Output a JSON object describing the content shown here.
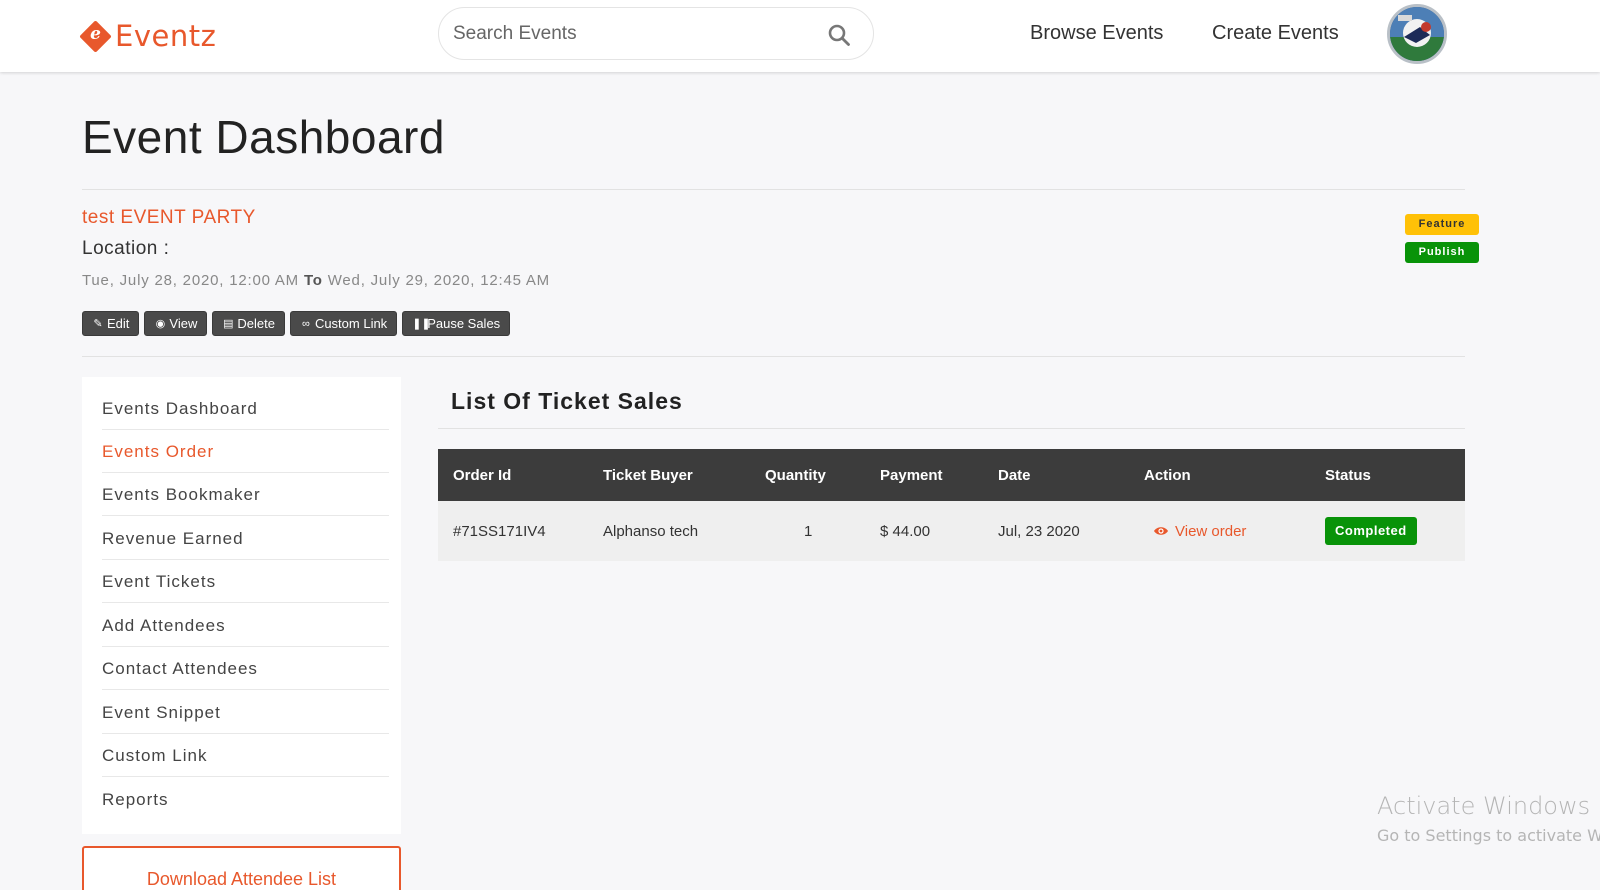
{
  "header": {
    "logo_letter": "e",
    "logo_text": "Eventz",
    "search_placeholder": "Search Events",
    "nav": [
      "Browse Events",
      "Create Events"
    ]
  },
  "dashboard": {
    "title": "Event Dashboard",
    "event_name": "test EVENT PARTY",
    "location_label": "Location :",
    "date_start": "Tue, July 28, 2020, 12:00 AM",
    "date_to": "To",
    "date_end": "Wed, July 29, 2020, 12:45 AM",
    "badges": {
      "feature": "Feature",
      "publish": "Publish"
    },
    "actions": {
      "edit": "Edit",
      "view": "View",
      "delete": "Delete",
      "custom_link": "Custom Link",
      "pause_sales": "Pause Sales"
    }
  },
  "sidebar": {
    "items": [
      "Events Dashboard",
      "Events Order",
      "Events Bookmaker",
      "Revenue Earned",
      "Event Tickets",
      "Add Attendees",
      "Contact Attendees",
      "Event Snippet",
      "Custom Link",
      "Reports"
    ],
    "active_index": 1,
    "download_label": "Download Attendee List"
  },
  "sales": {
    "title": "List Of Ticket Sales",
    "columns": [
      "Order Id",
      "Ticket Buyer",
      "Quantity",
      "Payment",
      "Date",
      "Action",
      "Status"
    ],
    "rows": [
      {
        "order_id": "#71SS171IV4",
        "buyer": "Alphanso tech",
        "quantity": "1",
        "payment": "$ 44.00",
        "date": "Jul, 23 2020",
        "action": "View order",
        "status": "Completed"
      }
    ]
  },
  "watermark": {
    "line1": "Activate Windows",
    "line2": "Go to Settings to activate Wi"
  },
  "colors": {
    "brand": "#e8582c",
    "feature": "#ffc107",
    "success": "#089308",
    "table_header": "#3c3c3c"
  }
}
